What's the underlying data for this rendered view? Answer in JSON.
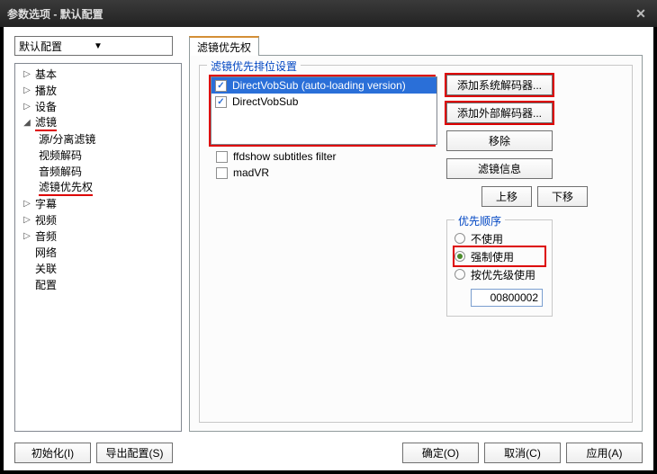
{
  "window": {
    "title": "参数选项 - 默认配置"
  },
  "profile": {
    "selected": "默认配置"
  },
  "tree": [
    {
      "label": "基本"
    },
    {
      "label": "播放"
    },
    {
      "label": "设备"
    },
    {
      "label": "滤镜",
      "children": [
        {
          "label": "源/分离滤镜"
        },
        {
          "label": "视频解码"
        },
        {
          "label": "音频解码"
        },
        {
          "label": "滤镜优先权"
        }
      ]
    },
    {
      "label": "字幕"
    },
    {
      "label": "视频"
    },
    {
      "label": "音频"
    },
    {
      "label": "网络"
    },
    {
      "label": "关联"
    },
    {
      "label": "配置"
    }
  ],
  "tabs": [
    {
      "label": "滤镜优先权"
    }
  ],
  "group": {
    "title": "滤镜优先排位设置"
  },
  "filters": [
    {
      "name": "DirectVobSub (auto-loading version)",
      "checked": true,
      "selected": true
    },
    {
      "name": "DirectVobSub",
      "checked": true
    },
    {
      "name": "ffdshow subtitles filter",
      "checked": false
    },
    {
      "name": "madVR",
      "checked": false
    }
  ],
  "buttons": {
    "add_system": "添加系统解码器...",
    "add_external": "添加外部解码器...",
    "remove": "移除",
    "info": "滤镜信息",
    "up": "上移",
    "down": "下移"
  },
  "priority": {
    "title": "优先顺序",
    "options": [
      "不使用",
      "强制使用",
      "按优先级使用"
    ],
    "selected": 1,
    "value": "00800002"
  },
  "bottom": {
    "init": "初始化(I)",
    "export": "导出配置(S)",
    "ok": "确定(O)",
    "cancel": "取消(C)",
    "apply": "应用(A)"
  }
}
